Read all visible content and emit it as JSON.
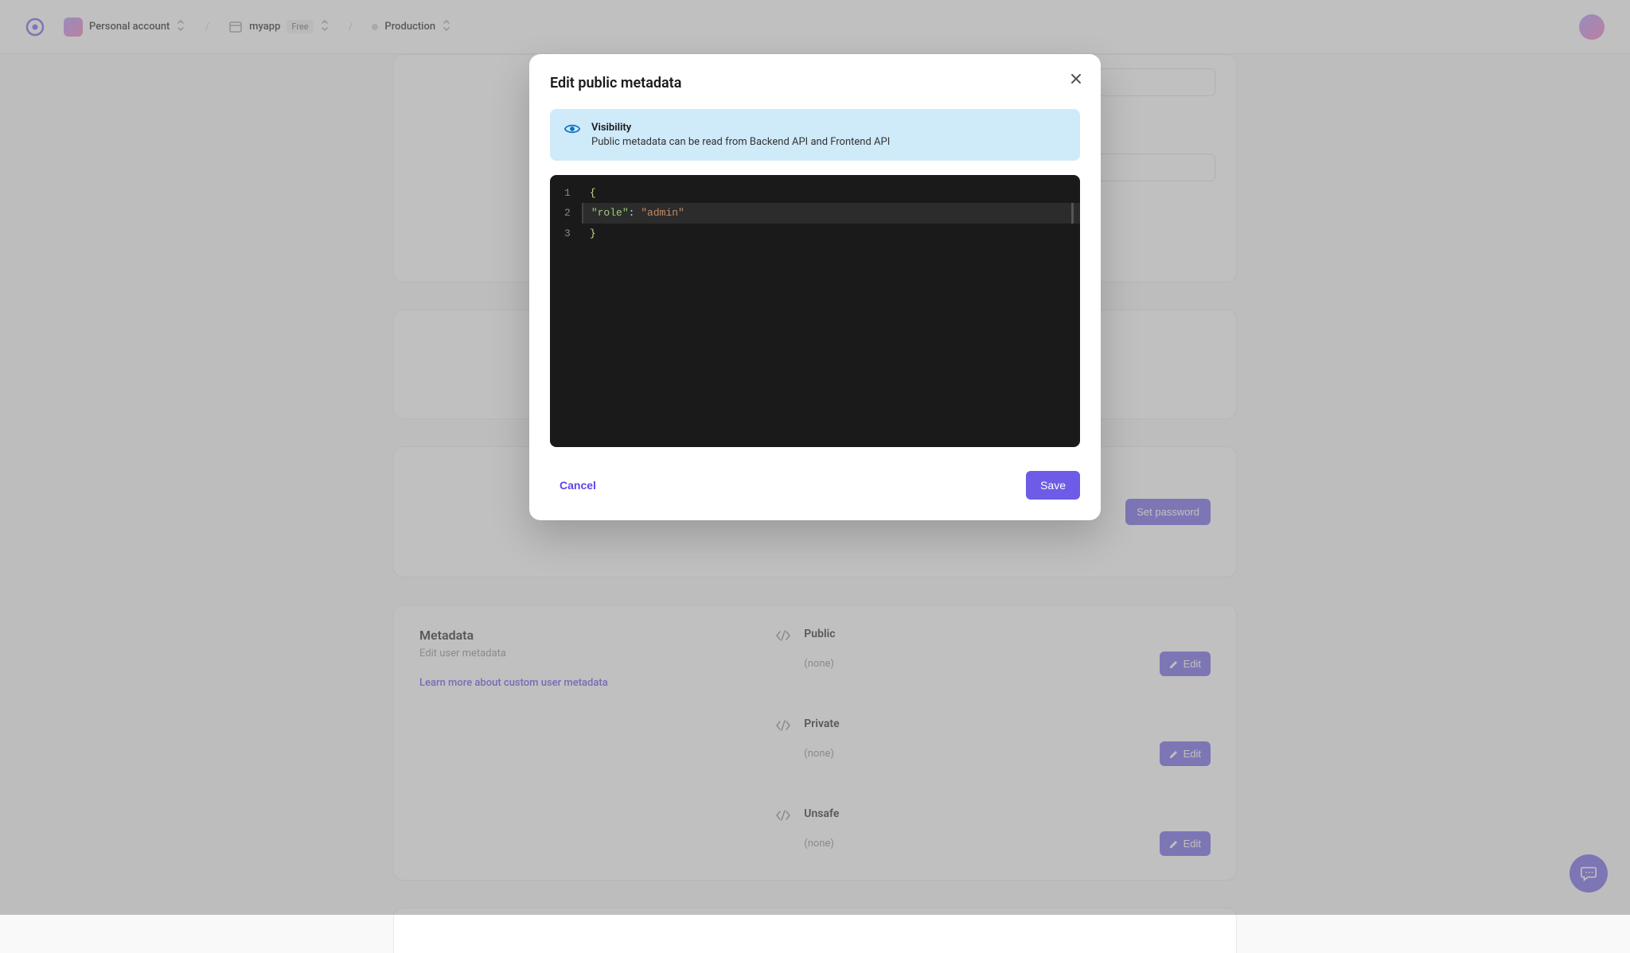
{
  "header": {
    "account_label": "Personal account",
    "app_name": "myapp",
    "plan_badge": "Free",
    "environment": "Production"
  },
  "background": {
    "set_password_label": "Set password",
    "metadata": {
      "title": "Metadata",
      "subtitle": "Edit user metadata",
      "learn_more": "Learn more about custom user metadata",
      "rows": [
        {
          "title": "Public",
          "value": "(none)",
          "edit_label": "Edit"
        },
        {
          "title": "Private",
          "value": "(none)",
          "edit_label": "Edit"
        },
        {
          "title": "Unsafe",
          "value": "(none)",
          "edit_label": "Edit"
        }
      ]
    }
  },
  "modal": {
    "title": "Edit public metadata",
    "notice_title": "Visibility",
    "notice_body": "Public metadata can be read from Backend API and Frontend API",
    "editor": {
      "line_numbers": [
        "1",
        "2",
        "3"
      ],
      "line1_brace": "{",
      "line2_key": "\"role\"",
      "line2_colon": ": ",
      "line2_value": "\"admin\"",
      "line3_brace": "}"
    },
    "cancel_label": "Cancel",
    "save_label": "Save"
  }
}
